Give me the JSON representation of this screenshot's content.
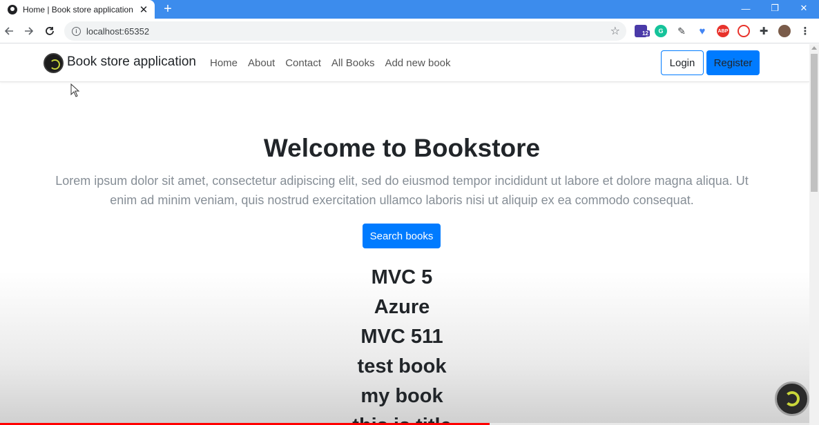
{
  "browser": {
    "tab_title": "Home | Book store application",
    "tab_close": "✕",
    "new_tab": "+",
    "url": "localhost:65352",
    "window_controls": [
      "—",
      "❐",
      "✕"
    ],
    "extensions": [
      {
        "name": "graduation-cap-icon",
        "badge": "12",
        "color": "#4a3aa8"
      },
      {
        "name": "grammarly-icon",
        "color": "#15c39a"
      },
      {
        "name": "eyedropper-icon",
        "color": "#3c4043"
      },
      {
        "name": "heart-icon",
        "color": "#4285f4"
      },
      {
        "name": "adblock-icon",
        "label": "ABP",
        "color": "#e8322b"
      },
      {
        "name": "lastpass-icon",
        "color": "#e8322b"
      },
      {
        "name": "puzzle-icon",
        "color": "#3c4043"
      }
    ]
  },
  "navbar": {
    "brand": "Book store application",
    "links": [
      "Home",
      "About",
      "Contact",
      "All Books",
      "Add new book"
    ],
    "login": "Login",
    "register": "Register"
  },
  "hero": {
    "title": "Welcome to Bookstore",
    "lead": "Lorem ipsum dolor sit amet, consectetur adipiscing elit, sed do eiusmod tempor incididunt ut labore et dolore magna aliqua. Ut enim ad minim veniam, quis nostrud exercitation ullamco laboris nisi ut aliquip ex ea commodo consequat.",
    "search_button": "Search books"
  },
  "books": [
    "MVC 5",
    "Azure",
    "MVC 511",
    "test book",
    "my book",
    "this is title"
  ],
  "video": {
    "progress": 0.605,
    "accent": "#ff0000"
  },
  "colors": {
    "primary": "#007bff",
    "chrome": "#3c8ced"
  }
}
